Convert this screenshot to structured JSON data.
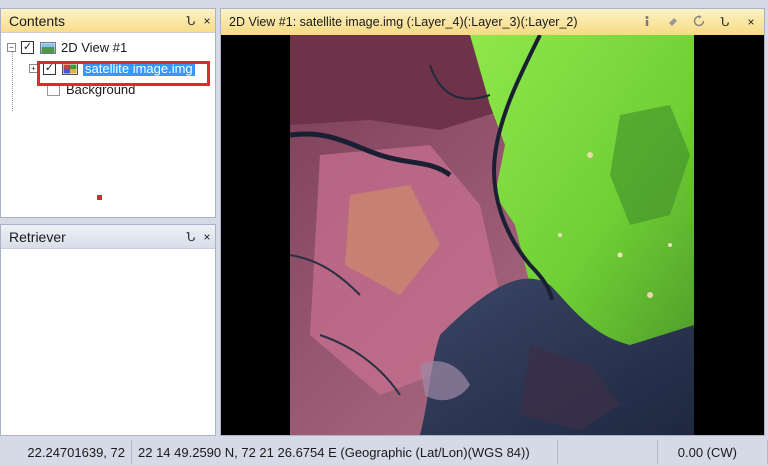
{
  "contents_panel": {
    "title": "Contents",
    "pin_glyph": "Ն",
    "close_glyph": "×",
    "tree": {
      "view_label": "2D View #1",
      "view_expander": "−",
      "view_checked": "✓",
      "layer_label": "satellite image.img",
      "layer_expander": "+",
      "layer_checked": "✓",
      "background_label": "Background"
    }
  },
  "retriever_panel": {
    "title": "Retriever",
    "pin_glyph": "Ն",
    "close_glyph": "×"
  },
  "view": {
    "title": "2D View #1: satellite image.img (:Layer_4)(:Layer_3)(:Layer_2)",
    "buttons": {
      "pin": "Ն",
      "close": "×"
    }
  },
  "status_bar": {
    "coordinate_decimal": "22.24701639, 72",
    "coordinate_dms": "22 14 49.2590 N,  72 21 26.6754 E (Geographic (Lat/Lon)(WGS 84))",
    "blank": "",
    "rotation": "0.00 (CW)"
  },
  "colors": {
    "header_accent": "#f8dd8a",
    "selection": "#3399ff",
    "highlight_outline": "#e0282e"
  }
}
